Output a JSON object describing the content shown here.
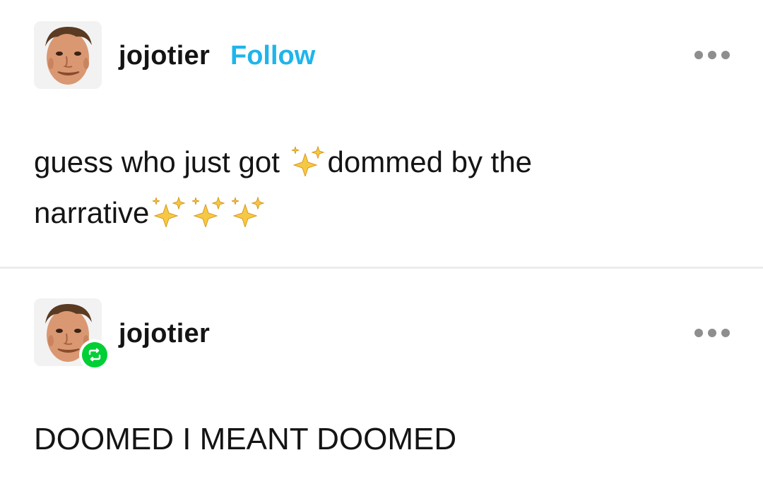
{
  "posts": [
    {
      "username": "jojotier",
      "follow_label": "Follow",
      "text_line1_a": "guess who just got ",
      "text_line1_b": "dommed by the",
      "text_line2": "narrative",
      "sparkle_icon": "sparkles-emoji",
      "more_icon": "more-options-icon"
    },
    {
      "username": "jojotier",
      "reblog_icon": "reblog-icon",
      "reblog_color": "#00cf35",
      "text": "DOOMED I MEANT DOOMED",
      "more_icon": "more-options-icon"
    }
  ],
  "colors": {
    "follow": "#1fb4ec",
    "divider": "#ececec",
    "more_dots": "#8e8e8e"
  }
}
